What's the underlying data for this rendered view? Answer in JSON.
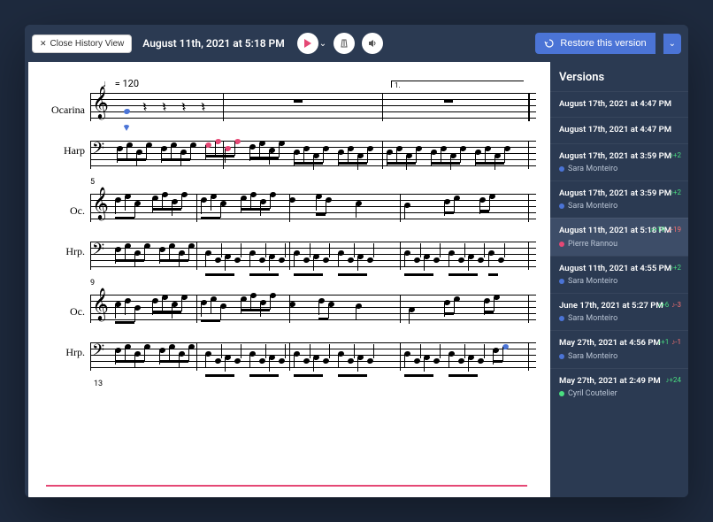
{
  "toolbar": {
    "close_label": "Close History View",
    "title": "August 11th, 2021 at 5:18 PM",
    "restore_label": "Restore this version"
  },
  "score": {
    "tempo_mark": "= 120",
    "instruments_full": [
      "Ocarina",
      "Harp"
    ],
    "instruments_abbr": [
      "Oc.",
      "Hrp."
    ],
    "measure_numbers": [
      5,
      9,
      13
    ],
    "volta_label": "1."
  },
  "versions": {
    "header": "Versions",
    "items": [
      {
        "date": "August 17th, 2021 at 4:47 PM",
        "user": null,
        "stats": null
      },
      {
        "date": "August 17th, 2021 at 4:47 PM",
        "user": null,
        "stats": null
      },
      {
        "date": "August 17th, 2021 at 3:59 PM",
        "user": "Sara Monteiro",
        "user_color": "#4b74d6",
        "stats": {
          "add": "+2"
        }
      },
      {
        "date": "August 17th, 2021 at 3:59 PM",
        "user": "Sara Monteiro",
        "user_color": "#4b74d6",
        "stats": {
          "add": "+2"
        }
      },
      {
        "date": "August 11th, 2021 at 5:18 PM",
        "user": "Pierre Rannou",
        "user_color": "#e54875",
        "stats": {
          "add": "+19",
          "del": "-19"
        },
        "selected": true
      },
      {
        "date": "August 11th, 2021 at 4:55 PM",
        "user": "Sara Monteiro",
        "user_color": "#4b74d6",
        "stats": {
          "add": "+2"
        }
      },
      {
        "date": "June 17th, 2021 at 5:27 PM",
        "user": "Sara Monteiro",
        "user_color": "#4b74d6",
        "stats": {
          "add": "+6",
          "del": "-3"
        }
      },
      {
        "date": "May 27th, 2021 at 4:56 PM",
        "user": "Sara Monteiro",
        "user_color": "#4b74d6",
        "stats": {
          "add": "+1",
          "del": "-1"
        }
      },
      {
        "date": "May 27th, 2021 at 2:49 PM",
        "user": "Cyril Coutelier",
        "user_color": "#4ade80",
        "stats": {
          "add": "+24"
        }
      }
    ]
  }
}
